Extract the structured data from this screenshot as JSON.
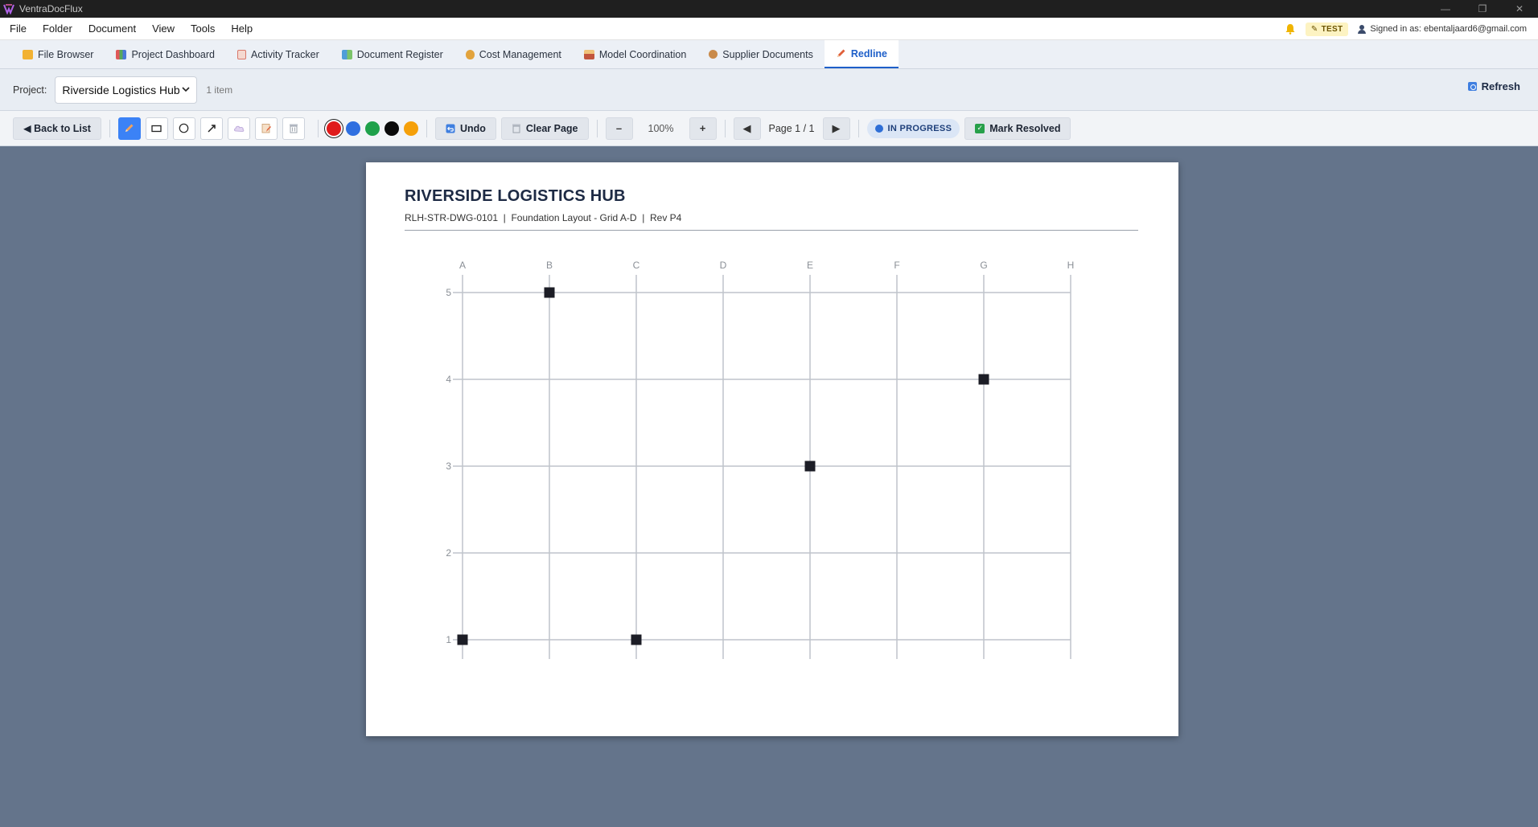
{
  "window": {
    "title": "VentraDocFlux",
    "minimize": "—",
    "restore": "❐",
    "close": "✕"
  },
  "menu": [
    "File",
    "Folder",
    "Document",
    "View",
    "Tools",
    "Help"
  ],
  "header": {
    "env_badge": "TEST",
    "signed_in": "Signed in as: ebentaljaard6@gmail.com"
  },
  "tabs": [
    {
      "label": "File Browser",
      "icon": "folder-icon",
      "color": "#f2b233"
    },
    {
      "label": "Project Dashboard",
      "icon": "chart-icon",
      "color": "#6a7fd8"
    },
    {
      "label": "Activity Tracker",
      "icon": "clipboard-icon",
      "color": "#d9776a"
    },
    {
      "label": "Document Register",
      "icon": "books-icon",
      "color": "#4f9ed9"
    },
    {
      "label": "Cost Management",
      "icon": "money-bag-icon",
      "color": "#e2a33d"
    },
    {
      "label": "Model Coordination",
      "icon": "building-icon",
      "color": "#c2553d"
    },
    {
      "label": "Supplier Documents",
      "icon": "package-icon",
      "color": "#c98a4a"
    },
    {
      "label": "Redline",
      "icon": "pencil-icon",
      "color": "#e0603a",
      "active": true
    }
  ],
  "project_bar": {
    "label": "Project:",
    "selected": "Riverside Logistics Hub",
    "count": "1 item",
    "refresh_label": "Refresh"
  },
  "toolbar": {
    "back_label": "◀ Back to List",
    "tools": [
      {
        "name": "pen-tool",
        "icon": "pencil-icon",
        "active": true
      },
      {
        "name": "rectangle-tool",
        "icon": "rectangle-icon"
      },
      {
        "name": "circle-tool",
        "icon": "circle-icon"
      },
      {
        "name": "arrow-tool",
        "icon": "arrow-icon"
      },
      {
        "name": "cloud-tool",
        "icon": "cloud-icon"
      },
      {
        "name": "text-tool",
        "icon": "text-note-icon"
      },
      {
        "name": "erase-tool",
        "icon": "trash-icon"
      }
    ],
    "colors": [
      "#e01b1b",
      "#2f6fe0",
      "#1fa14a",
      "#0a0a0a",
      "#f5a00a"
    ],
    "selected_color": "#e01b1b",
    "undo_label": "Undo",
    "clear_label": "Clear Page",
    "zoom_out": "–",
    "zoom_value": "100%",
    "zoom_in": "+",
    "prev_page": "◀",
    "page_label": "Page 1 / 1",
    "next_page": "▶",
    "status": "IN PROGRESS",
    "resolve_label": "Mark Resolved"
  },
  "drawing": {
    "title": "RIVERSIDE LOGISTICS HUB",
    "subtitle": "RLH-STR-DWG-0101  |  Foundation Layout - Grid A-D  |  Rev P4",
    "grid_columns": [
      "A",
      "B",
      "C",
      "D",
      "E",
      "F",
      "G",
      "H"
    ],
    "grid_rows": [
      "5",
      "4",
      "3",
      "2",
      "1"
    ],
    "columns_marked": [
      {
        "col": "B",
        "row": "5"
      },
      {
        "col": "G",
        "row": "4"
      },
      {
        "col": "E",
        "row": "3"
      },
      {
        "col": "A",
        "row": "1"
      },
      {
        "col": "C",
        "row": "1"
      }
    ]
  }
}
